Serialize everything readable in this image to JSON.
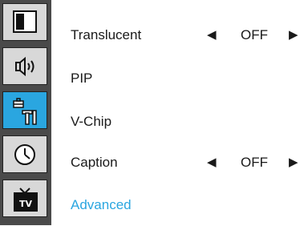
{
  "sidebar": {
    "tabs": [
      {
        "icon": "picture-icon",
        "active": false
      },
      {
        "icon": "sound-icon",
        "active": false
      },
      {
        "icon": "setup-tools-icon",
        "active": true
      },
      {
        "icon": "clock-icon",
        "active": false
      },
      {
        "icon": "tv-icon",
        "active": false,
        "icon_text": "TV"
      }
    ]
  },
  "menu": {
    "items": [
      {
        "label": "Translucent",
        "value": "OFF",
        "left_arrow": "◀",
        "right_arrow": "▶"
      },
      {
        "label": "PIP"
      },
      {
        "label": "V-Chip"
      },
      {
        "label": "Caption",
        "value": "OFF",
        "left_arrow": "◀",
        "right_arrow": "▶"
      },
      {
        "label": "Advanced",
        "selected": true
      }
    ]
  },
  "colors": {
    "sidebar_bg": "#4a4a4a",
    "tile_bg": "#d8d8d8",
    "accent": "#2aa6e0",
    "text": "#1a1a1a"
  }
}
